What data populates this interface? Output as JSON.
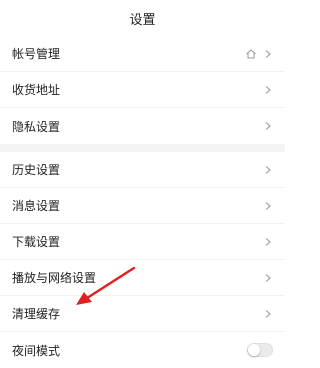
{
  "header": {
    "title": "设置"
  },
  "section1": [
    {
      "label": "帐号管理",
      "right_icon": "home-icon"
    },
    {
      "label": "收货地址"
    },
    {
      "label": "隐私设置"
    }
  ],
  "section2": [
    {
      "label": "历史设置"
    },
    {
      "label": "消息设置"
    },
    {
      "label": "下载设置"
    },
    {
      "label": "播放与网络设置"
    },
    {
      "label": "清理缓存"
    },
    {
      "label": "夜间模式",
      "toggle": false
    }
  ],
  "colors": {
    "annotation_arrow": "#e02020",
    "chevron": "#9a9a9a"
  },
  "icons": {
    "chevron": "chevron-right-icon"
  }
}
